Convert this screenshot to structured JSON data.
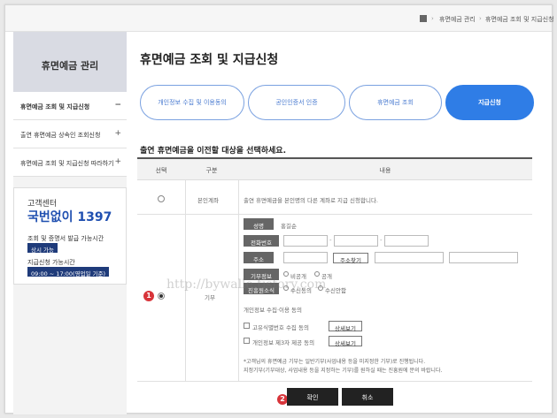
{
  "breadcrumb": {
    "items": [
      "휴면예금 관리",
      "휴면예금 조회 및 지급신청"
    ]
  },
  "sidebar": {
    "title": "휴면예금 관리",
    "items": [
      {
        "label": "휴면예금 조회 및 지급신청",
        "toggle": "−"
      },
      {
        "label": "출연 휴면예금 상속인 조회신청",
        "toggle": "+"
      },
      {
        "label": "휴면예금 조회 및 지급신청 따라하기",
        "toggle": "+"
      }
    ]
  },
  "customer_center": {
    "title": "고객센터",
    "number": "국번없이 1397",
    "cert_label": "조회 및 증명서 발급 가능시간",
    "cert_hours": "상시 가능",
    "apply_label": "지급신청 가능시간",
    "apply_hours": "09:00 ~ 17:00(영업일 기준)"
  },
  "page": {
    "title": "휴면예금 조회 및 지급신청",
    "instruction": "출연 휴면예금을 이전할 대상을 선택하세요."
  },
  "steps": [
    {
      "label": "개인정보 수집 및 이용동의",
      "active": false
    },
    {
      "label": "공인인증서 인증",
      "active": false
    },
    {
      "label": "휴면예금 조회",
      "active": false
    },
    {
      "label": "지급신청",
      "active": true
    }
  ],
  "table": {
    "headers": {
      "select": "선택",
      "category": "구분",
      "content": "내용"
    },
    "row1": {
      "category": "본인계좌",
      "content": "출연 휴면예금을 본인명의 다른 계좌로 지급 신청합니다."
    },
    "row2": {
      "category": "기부",
      "fields": {
        "name_label": "성명",
        "name_value": "홍길순",
        "phone_label": "전화번호",
        "address_label": "주소",
        "address_button": "주소찾기",
        "disclosure_label": "기부정보",
        "disclosure_options": [
          "비공개",
          "공개"
        ],
        "receipt_label": "진흥원소식",
        "receipt_options": [
          "수신동의",
          "수신안함"
        ],
        "consent_title": "개인정보 수집·이용 동의",
        "consent_items": [
          {
            "label": "고유식별번호 수집 동의",
            "button": "상세보기"
          },
          {
            "label": "개인정보 제3자 제공 동의",
            "button": "상세보기"
          }
        ],
        "notes": [
          "*고객님의 휴면예금 기부는 일반기부(사업내용 등을 미지정한 기부)로 진행됩니다.",
          "지정기부(기부대상, 사업내용 등을 지정하는 기부)를 원하실 때는 진흥원에 문의 바랍니다."
        ]
      }
    }
  },
  "annotations": [
    "1",
    "2"
  ],
  "watermark": "http://bywalle.tistory.com",
  "buttons": {
    "confirm": "확인",
    "cancel": "취소"
  }
}
